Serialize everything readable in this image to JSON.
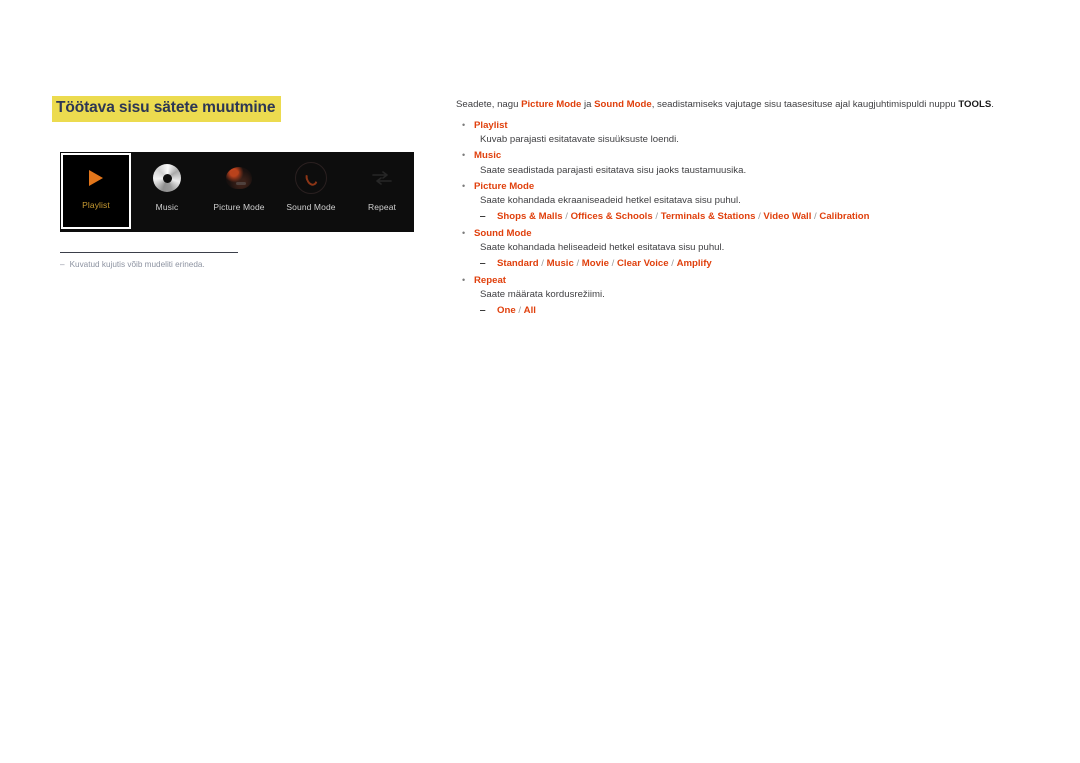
{
  "page": {
    "title": "Töötava sisu sätete muutmine"
  },
  "figure": {
    "items": [
      {
        "label": "Playlist",
        "icon": "play-triangle-icon",
        "selected": true
      },
      {
        "label": "Music",
        "icon": "compact-disc-icon",
        "selected": false
      },
      {
        "label": "Picture Mode",
        "icon": "picture-thumbnail-icon",
        "selected": false
      },
      {
        "label": "Sound Mode",
        "icon": "sound-ring-icon",
        "selected": false
      },
      {
        "label": "Repeat",
        "icon": "repeat-arrows-icon",
        "selected": false
      }
    ],
    "note_dash": "‒",
    "note_text": "Kuvatud kujutis võib mudeliti erineda."
  },
  "content": {
    "intro": {
      "part1": "Seadete, nagu ",
      "kw1": "Picture Mode",
      "part2": " ja ",
      "kw2": "Sound Mode",
      "part3": ", seadistamiseks vajutage sisu taasesituse ajal kaugjuhtimispuldi nuppu ",
      "kw3": "TOOLS",
      "part4": "."
    },
    "bullet_marker": "•",
    "sub_marker": "‒",
    "items": [
      {
        "title": "Playlist",
        "desc": "Kuvab parajasti esitatavate sisuüksuste loendi.",
        "options": []
      },
      {
        "title": "Music",
        "desc": "Saate seadistada parajasti esitatava sisu jaoks taustamuusika.",
        "options": []
      },
      {
        "title": "Picture Mode",
        "desc": "Saate kohandada ekraaniseadeid hetkel esitatava sisu puhul.",
        "options": [
          "Shops & Malls",
          "Offices & Schools",
          "Terminals & Stations",
          "Video Wall",
          "Calibration"
        ]
      },
      {
        "title": "Sound Mode",
        "desc": "Saate kohandada heliseadeid hetkel esitatava sisu puhul.",
        "options": [
          "Standard",
          "Music",
          "Movie",
          "Clear Voice",
          "Amplify"
        ]
      },
      {
        "title": "Repeat",
        "desc": "Saate määrata kordusrežiimi.",
        "options": [
          "One",
          "All"
        ]
      }
    ]
  },
  "colors": {
    "accent_red": "#e0400d",
    "title_highlight": "#ecdb4f",
    "title_text": "#2c3654",
    "body_text": "#3f3f42",
    "note_text": "#8d93a1",
    "device_bg": "#0d0d0d",
    "selected_label": "#c89b32"
  }
}
